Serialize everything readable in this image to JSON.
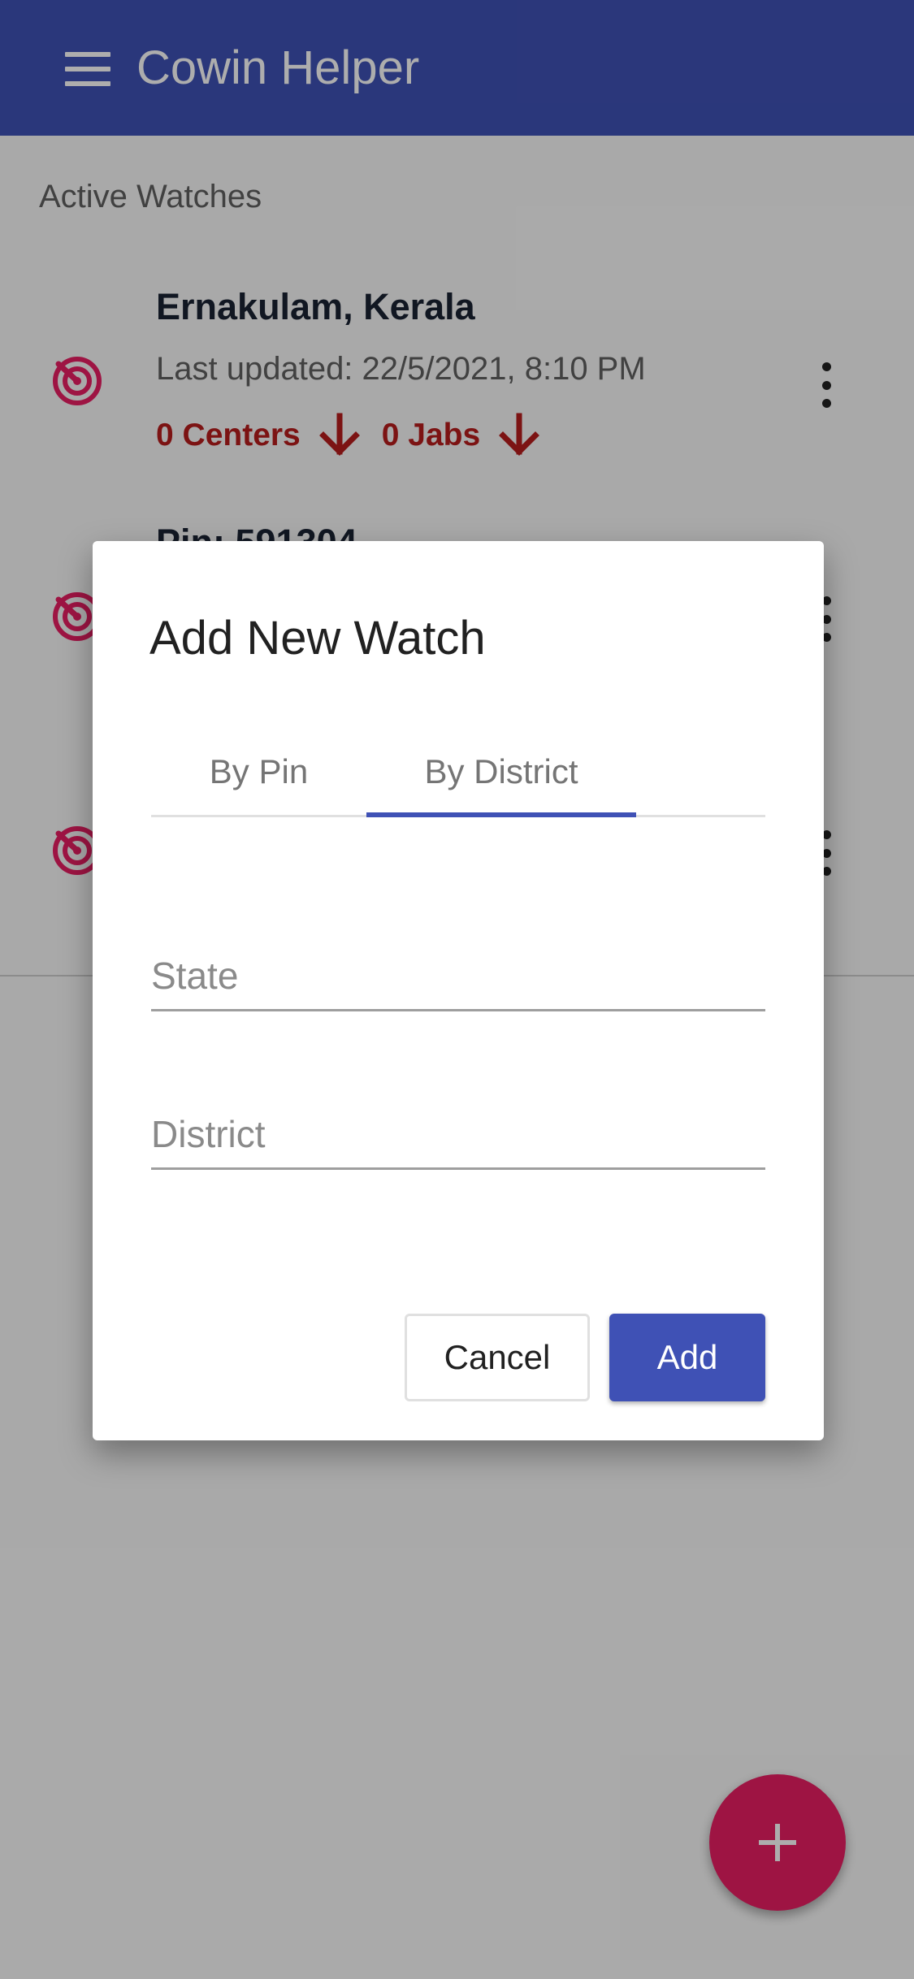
{
  "app": {
    "title": "Cowin Helper",
    "menu_icon": "hamburger-menu-icon"
  },
  "colors": {
    "primary": "#3f51b5",
    "accent": "#e91e63",
    "alert": "#b71c1c"
  },
  "section_title": "Active Watches",
  "watches": [
    {
      "name": "Ernakulam, Kerala",
      "updated": "Last updated: 22/5/2021, 8:10 PM",
      "centers": "0 Centers",
      "jabs": "0 Jabs"
    },
    {
      "name": "Pin: 591304",
      "updated": "",
      "centers": "",
      "jabs": ""
    },
    {
      "name": "",
      "updated": "",
      "centers": "",
      "jabs": ""
    }
  ],
  "dialog": {
    "title": "Add New Watch",
    "tabs": [
      {
        "label": "By Pin",
        "selected": false
      },
      {
        "label": "By District",
        "selected": true
      }
    ],
    "state_placeholder": "State",
    "district_placeholder": "District",
    "cancel_label": "Cancel",
    "add_label": "Add"
  },
  "fab": {
    "icon": "plus-icon"
  }
}
